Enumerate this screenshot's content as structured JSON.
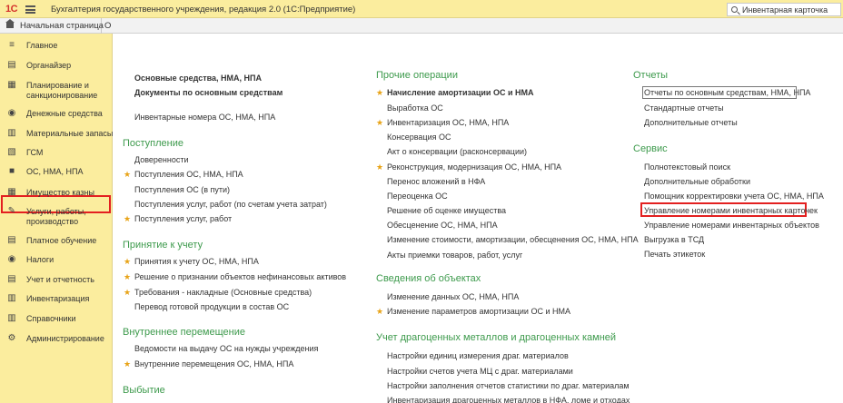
{
  "titlebar": {
    "logo": "1С",
    "app_title": "Бухгалтерия государственного учреждения, редакция 2.0  (1С:Предприятие)",
    "search_value": "Инвентарная карточка"
  },
  "tabs": {
    "home": "Начальная страница",
    "other": "О"
  },
  "sidebar": {
    "items": [
      {
        "label": "Главное",
        "icon": "≡"
      },
      {
        "label": "Органайзер",
        "icon": "▤"
      },
      {
        "label": "Планирование и\nсанкционирование",
        "icon": "▦"
      },
      {
        "label": "Денежные средства",
        "icon": "◉"
      },
      {
        "label": "Материальные запасы",
        "icon": "▥"
      },
      {
        "label": "ГСМ",
        "icon": "▧"
      },
      {
        "label": "ОС, НМА, НПА",
        "icon": "■"
      },
      {
        "label": "Имущество казны",
        "icon": "▦"
      },
      {
        "label": "Услуги, работы,\nпроизводство",
        "icon": "✎"
      },
      {
        "label": "Платное обучение",
        "icon": "▤"
      },
      {
        "label": "Налоги",
        "icon": "◉"
      },
      {
        "label": "Учет и отчетность",
        "icon": "▤"
      },
      {
        "label": "Инвентаризация",
        "icon": "▥"
      },
      {
        "label": "Справочники",
        "icon": "▥"
      },
      {
        "label": "Администрирование",
        "icon": "⚙"
      }
    ]
  },
  "col1": {
    "top_links": [
      "Основные средства, НМА, НПА",
      "Документы по основным средствам"
    ],
    "inventory_numbers": "Инвентарные номера ОС, НМА, НПА",
    "receipt_head": "Поступление",
    "receipt": [
      "Доверенности",
      "Поступления ОС, НМА, НПА",
      "Поступления ОС (в пути)",
      "Поступления услуг, работ (по счетам учета затрат)",
      "Поступления услуг, работ"
    ],
    "accept_head": "Принятие к учету",
    "accept": [
      "Принятия к учету ОС, НМА, НПА",
      "Решение о признании объектов нефинансовых активов",
      "Требования - накладные (Основные средства)",
      "Перевод готовой продукции в состав ОС"
    ],
    "move_head": "Внутреннее перемещение",
    "move": [
      "Ведомости на выдачу ОС на нужды учреждения",
      "Внутренние перемещения ОС, НМА, НПА"
    ],
    "disposal_head": "Выбытие"
  },
  "col2": {
    "other_head": "Прочие операции",
    "other": [
      "Начисление амортизации ОС и НМА",
      "Выработка ОС",
      "Инвентаризация ОС, НМА, НПА",
      "Консервация ОС",
      "Акт о консервации (расконсервации)",
      "Реконструкция, модернизация ОС, НМА, НПА",
      "Перенос вложений в НФА",
      "Переоценка ОС",
      "Решение об оценке имущества",
      "Обесценение ОС, НМА, НПА",
      "Изменение стоимости, амортизации, обесценения ОС, НМА, НПА",
      "Акты приемки товаров, работ, услуг"
    ],
    "objects_head": "Сведения об объектах",
    "objects": [
      "Изменение данных ОС, НМА, НПА",
      "Изменение параметров амортизации ОС и НМА"
    ],
    "precious_head": "Учет драгоценных металлов и драгоценных камней",
    "precious": [
      "Настройки единиц измерения драг. материалов",
      "Настройки счетов учета МЦ с драг. материалами",
      "Настройки заполнения отчетов статистики по драг. материалам",
      "Инвентаризация драгоценных металлов в НФА, ломе и отходах"
    ]
  },
  "col3": {
    "reports_head": "Отчеты",
    "reports": [
      "Отчеты по основным средствам, НМА, НПА",
      "Стандартные отчеты",
      "Дополнительные отчеты"
    ],
    "service_head": "Сервис",
    "service": [
      "Полнотекстовый поиск",
      "Дополнительные обработки",
      "Помощник корректировки учета ОС, НМА, НПА",
      "Управление номерами инвентарных карточек",
      "Управление номерами инвентарных объектов",
      "Выгрузка в ТСД",
      "Печать этикеток"
    ]
  },
  "colors": {
    "header_bg": "#fbed9e",
    "section_green": "#3d9a4c",
    "star": "#e8a317",
    "highlight_red": "#e32020"
  }
}
